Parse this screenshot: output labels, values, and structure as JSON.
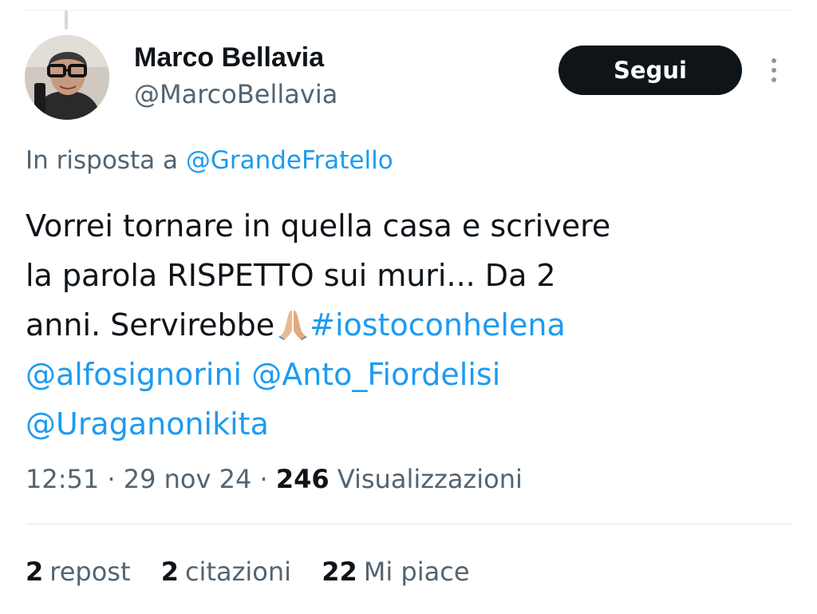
{
  "author": {
    "name": "Marco Bellavia",
    "handle": "@MarcoBellavia"
  },
  "follow_label": "Segui",
  "reply": {
    "prefix": "In risposta a",
    "handle": "@GrandeFratello"
  },
  "tweet": {
    "line1": "Vorrei tornare in quella casa e scrivere",
    "line2": "la parola RISPETTO sui muri... Da 2",
    "line3_text": "anni. Servirebbe",
    "emoji": "folded-hands-emoji",
    "hashtag": "#iostoconhelena",
    "mention1": "@alfosignorini",
    "mention2": "@Anto_Fiordelisi",
    "mention3": "@Uraganonikita"
  },
  "meta": {
    "time": "12:51",
    "separator": "·",
    "date": "29 nov 24",
    "views_count": "246",
    "views_label": "Visualizzazioni"
  },
  "stats": {
    "reposts_count": "2",
    "reposts_label": "repost",
    "quotes_count": "2",
    "quotes_label": "citazioni",
    "likes_count": "22",
    "likes_label": "Mi piace"
  },
  "colors": {
    "link": "#1d9bf0",
    "text": "#0f1419",
    "secondary": "#536471",
    "button_bg": "#0f1419"
  }
}
